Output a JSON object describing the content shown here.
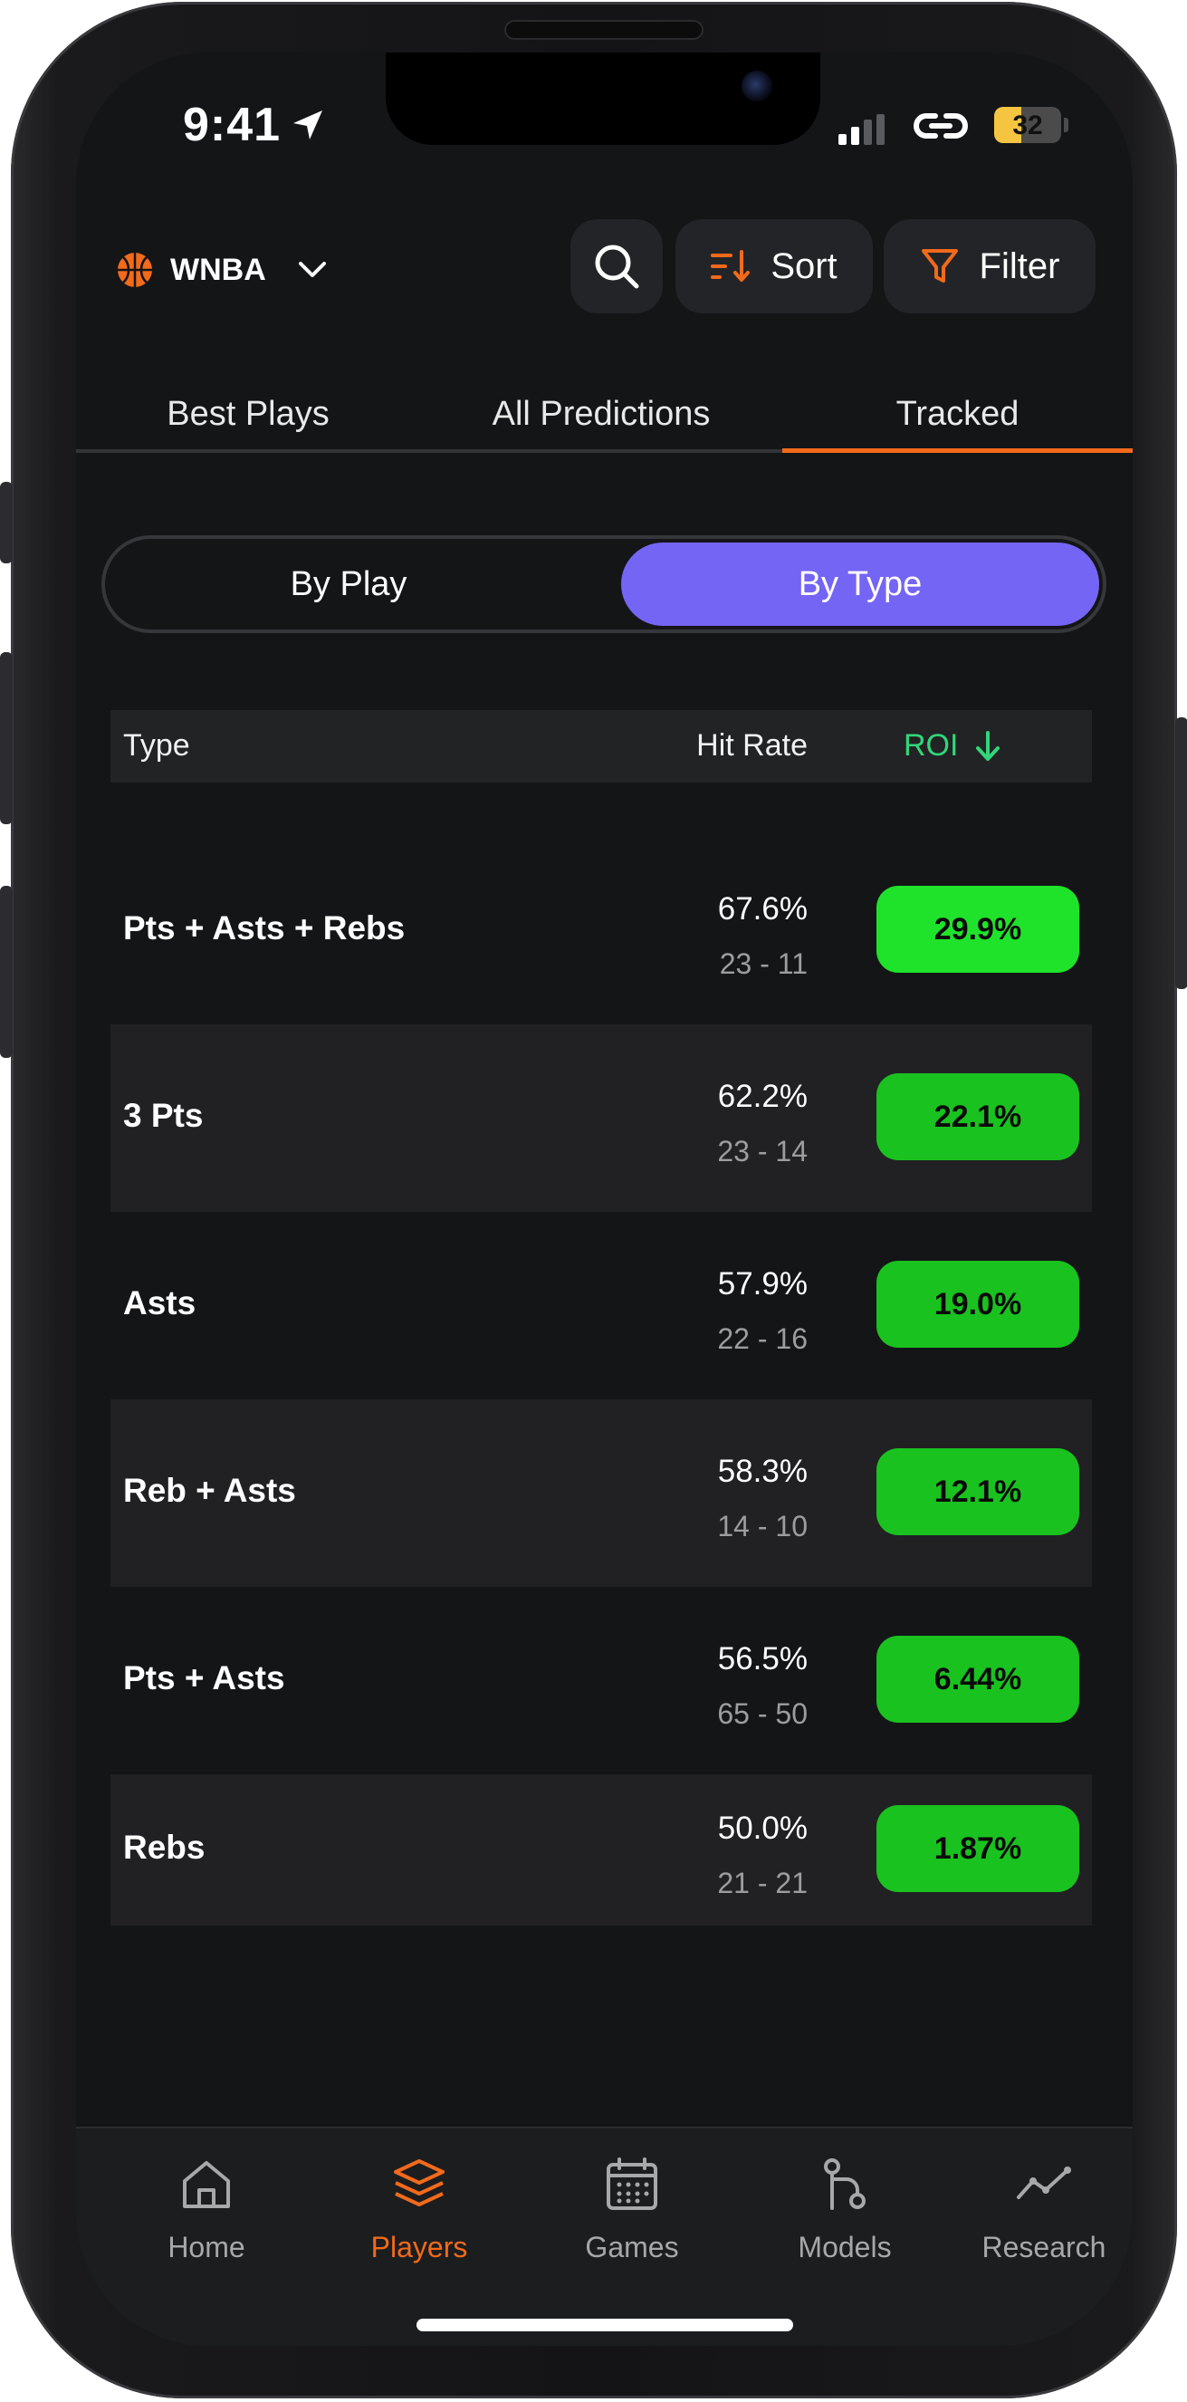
{
  "status_bar": {
    "time": "9:41",
    "battery": "32"
  },
  "header": {
    "league": "WNBA",
    "sort_label": "Sort",
    "filter_label": "Filter"
  },
  "tabs": [
    {
      "label": "Best Plays",
      "active": false
    },
    {
      "label": "All Predictions",
      "active": false
    },
    {
      "label": "Tracked",
      "active": true
    }
  ],
  "segment": {
    "options": [
      "By Play",
      "By Type"
    ],
    "selected": "By Type"
  },
  "table": {
    "headers": {
      "type": "Type",
      "hit_rate": "Hit Rate",
      "roi": "ROI"
    },
    "sort": {
      "column": "ROI",
      "direction": "descending"
    },
    "rows": [
      {
        "type": "Pts + Asts + Rebs",
        "hit_rate": "67.6%",
        "record": "23 - 11",
        "roi": "29.9%"
      },
      {
        "type": "3 Pts",
        "hit_rate": "62.2%",
        "record": "23 - 14",
        "roi": "22.1%"
      },
      {
        "type": "Asts",
        "hit_rate": "57.9%",
        "record": "22 - 16",
        "roi": "19.0%"
      },
      {
        "type": "Reb + Asts",
        "hit_rate": "58.3%",
        "record": "14 - 10",
        "roi": "12.1%"
      },
      {
        "type": "Pts + Asts",
        "hit_rate": "56.5%",
        "record": "65 - 50",
        "roi": "6.44%"
      },
      {
        "type": "Rebs",
        "hit_rate": "50.0%",
        "record": "21 - 21",
        "roi": "1.87%"
      }
    ]
  },
  "bottom_nav": [
    {
      "label": "Home",
      "icon": "home-icon",
      "active": false
    },
    {
      "label": "Players",
      "icon": "layers-icon",
      "active": true
    },
    {
      "label": "Games",
      "icon": "calendar-icon",
      "active": false
    },
    {
      "label": "Models",
      "icon": "model-icon",
      "active": false
    },
    {
      "label": "Research",
      "icon": "trend-icon",
      "active": false
    }
  ],
  "colors": {
    "background": "#141517",
    "accent_orange": "#f26a1b",
    "segment_active": "#7565f4",
    "roi_header": "#31d679",
    "roi_badge": "#19c21f"
  }
}
